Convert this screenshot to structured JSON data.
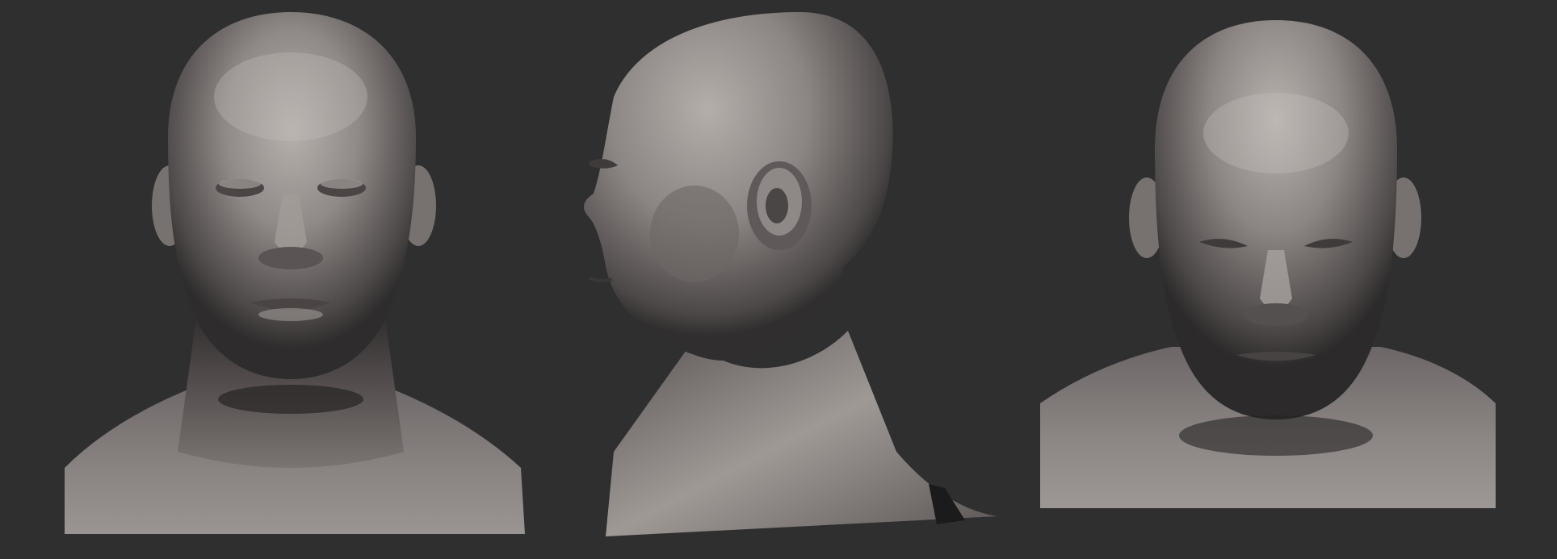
{
  "scene": {
    "background_color": "#2f2f2f",
    "material_color": "#8a8584",
    "views": [
      {
        "id": "front",
        "label": ""
      },
      {
        "id": "side",
        "label": ""
      },
      {
        "id": "front-down",
        "label": ""
      }
    ]
  }
}
